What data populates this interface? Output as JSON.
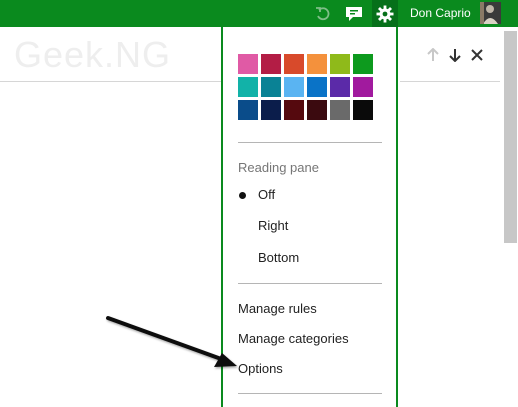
{
  "topbar": {
    "user_name": "Don Caprio",
    "icons": [
      "undo-icon",
      "chat-icon",
      "gear-icon"
    ],
    "accent": "#0a8a1e"
  },
  "watermark": "Geek.NG",
  "message_actions": [
    "up-arrow-icon",
    "down-arrow-icon",
    "close-icon"
  ],
  "settings_menu": {
    "theme_colors": [
      "#e05aa5",
      "#b31d45",
      "#d84a2b",
      "#f4913c",
      "#8fba1a",
      "#0d9a1e",
      "#12b2a8",
      "#0a8295",
      "#5ab4f2",
      "#0a73c7",
      "#5b2aa8",
      "#a11a9e",
      "#0a4c8a",
      "#0b1d4b",
      "#55090e",
      "#3b0a0f",
      "#6a6a6a",
      "#0a0a0a"
    ],
    "reading_pane": {
      "heading": "Reading pane",
      "options": [
        "Off",
        "Right",
        "Bottom"
      ],
      "selected": "Off"
    },
    "items": [
      "Manage rules",
      "Manage categories",
      "Options"
    ]
  }
}
